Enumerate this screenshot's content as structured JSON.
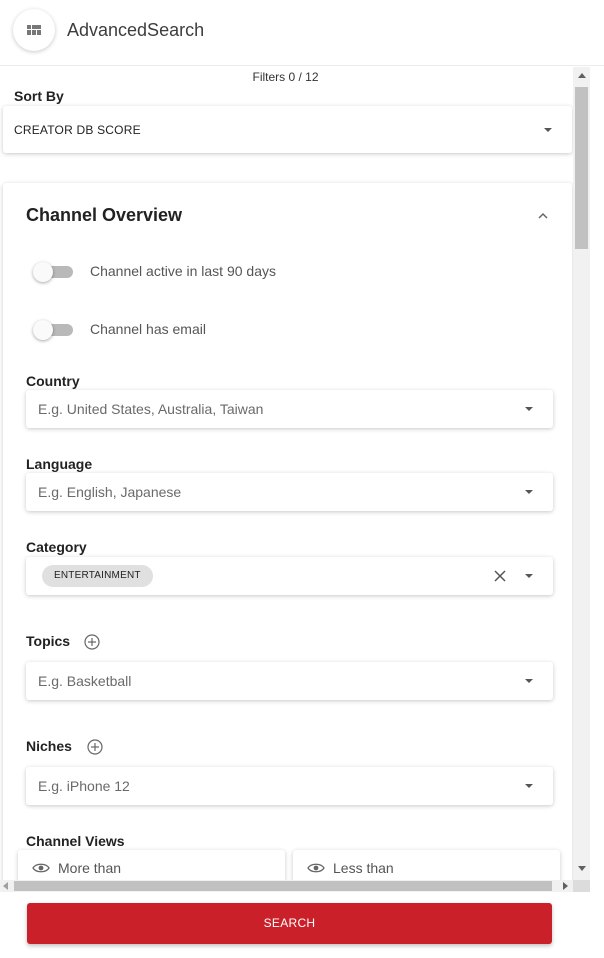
{
  "app": {
    "title": "AdvancedSearch"
  },
  "filters_count": "Filters 0 / 12",
  "sort_by": {
    "label": "Sort By",
    "value": "CREATOR DB SCORE"
  },
  "channel_overview": {
    "title": "Channel Overview",
    "toggles": [
      {
        "label": "Channel active in last 90 days",
        "on": false
      },
      {
        "label": "Channel has email",
        "on": false
      }
    ],
    "country": {
      "label": "Country",
      "placeholder": "E.g. United States, Australia, Taiwan"
    },
    "language": {
      "label": "Language",
      "placeholder": "E.g. English, Japanese"
    },
    "category": {
      "label": "Category",
      "chips": [
        "ENTERTAINMENT"
      ]
    },
    "topics": {
      "label": "Topics",
      "placeholder": "E.g. Basketball"
    },
    "niches": {
      "label": "Niches",
      "placeholder": "E.g. iPhone 12"
    },
    "channel_views": {
      "label": "Channel Views",
      "more_than": "More than",
      "less_than": "Less than"
    }
  },
  "search_button": {
    "label": "SEARCH"
  },
  "colors": {
    "primary": "#c9202a",
    "toggle_track": "#b9b9b9",
    "chip_bg": "#e0e0e0"
  }
}
